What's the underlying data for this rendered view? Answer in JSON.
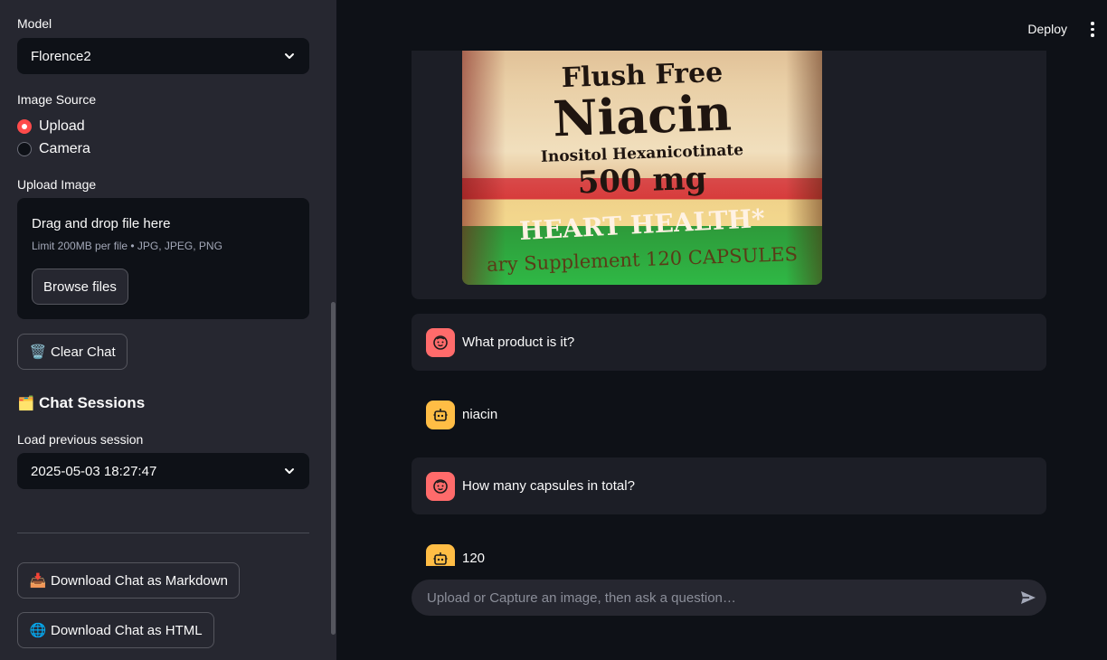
{
  "sidebar": {
    "model_label": "Model",
    "model_value": "Florence2",
    "image_source_label": "Image Source",
    "image_source_options": [
      "Upload",
      "Camera"
    ],
    "upload_label": "Upload Image",
    "uploader_title": "Drag and drop file here",
    "uploader_limits": "Limit 200MB per file • JPG, JPEG, PNG",
    "browse_label": "Browse files",
    "clear_emoji": "🗑️",
    "clear_label": "Clear Chat",
    "sessions_emoji": "🗂️",
    "sessions_title": "Chat Sessions",
    "load_label": "Load previous session",
    "session_value": "2025-05-03 18:27:47",
    "download_md_emoji": "📥",
    "download_md_label": "Download Chat as Markdown",
    "download_html_emoji": "🌐",
    "download_html_label": "Download Chat as HTML"
  },
  "header": {
    "deploy_label": "Deploy"
  },
  "image_labels": {
    "line1": "Flush Free",
    "line2": "Niacin",
    "line3": "Inositol Hexanicotinate",
    "line4": "500 mg",
    "line5": "HEART HEALTH*",
    "line6": "ary Supplement    120 CAPSULES"
  },
  "messages": [
    {
      "role": "user",
      "text": "What product is it?"
    },
    {
      "role": "assistant",
      "text": "niacin"
    },
    {
      "role": "user",
      "text": "How many capsules in total?"
    },
    {
      "role": "assistant",
      "text": "120"
    }
  ],
  "chat_input": {
    "placeholder": "Upload or Capture an image, then ask a question…"
  },
  "colors": {
    "accent": "#ff4b4b",
    "user_avatar": "#ff6b6b",
    "bot_avatar": "#ffbd45"
  }
}
